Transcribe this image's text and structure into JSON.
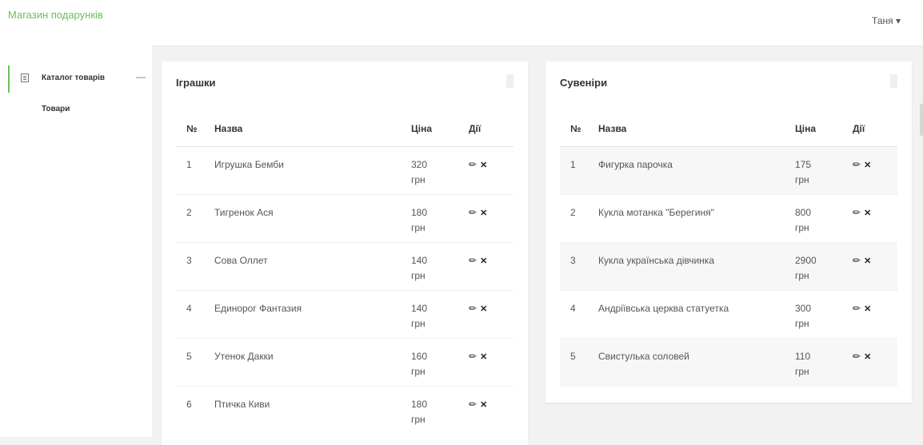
{
  "app": {
    "brand": "Магазин подарунків",
    "user": "Таня ▾"
  },
  "sidebar": {
    "group_label": "Каталог товарів",
    "group_toggle": "—",
    "sub_item": "Товари"
  },
  "columns": {
    "num": "№",
    "name": "Назва",
    "price": "Ціна",
    "actions": "Дії"
  },
  "icons": {
    "edit": "pencil-icon",
    "delete": "close-icon",
    "catalog": "document-icon"
  },
  "colors": {
    "accent": "#6abf56"
  },
  "toys": {
    "title": "Іграшки",
    "rows": [
      {
        "num": "1",
        "name": "Игрушка Бемби",
        "price": "320",
        "unit": "грн"
      },
      {
        "num": "2",
        "name": "Тигренок Ася",
        "price": "180",
        "unit": "грн"
      },
      {
        "num": "3",
        "name": "Сова Оллет",
        "price": "140",
        "unit": "грн"
      },
      {
        "num": "4",
        "name": "Единорог Фантазия",
        "price": "140",
        "unit": "грн"
      },
      {
        "num": "5",
        "name": "Утенок Дакки",
        "price": "160",
        "unit": "грн"
      },
      {
        "num": "6",
        "name": "Птичка Киви",
        "price": "180",
        "unit": "грн"
      }
    ]
  },
  "souvenirs": {
    "title": "Сувеніри",
    "rows": [
      {
        "num": "1",
        "name": "Фигурка парочка",
        "price": "175",
        "unit": "грн"
      },
      {
        "num": "2",
        "name": "Кукла мотанка \"Берегиня\"",
        "price": "800",
        "unit": "грн"
      },
      {
        "num": "3",
        "name": "Кукла українська дівчинка",
        "price": "2900",
        "unit": "грн"
      },
      {
        "num": "4",
        "name": "Андріївська церква статуетка",
        "price": "300",
        "unit": "грн"
      },
      {
        "num": "5",
        "name": "Свистулька соловей",
        "price": "110",
        "unit": "грн"
      }
    ]
  }
}
